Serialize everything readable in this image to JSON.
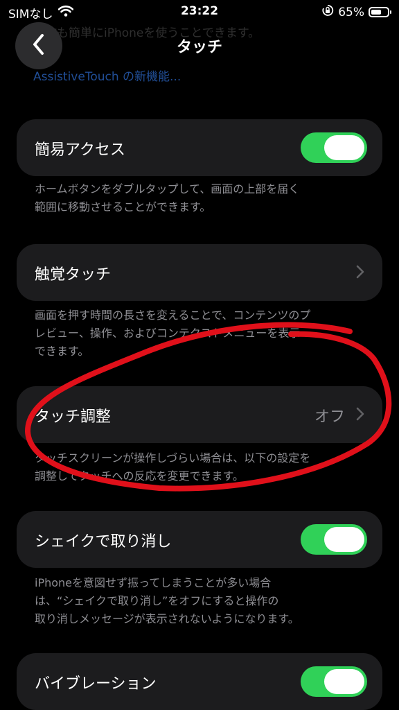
{
  "status": {
    "carrier": "SIMなし",
    "time": "23:22",
    "battery": "65%",
    "battery_level": 0.65
  },
  "background_text": {
    "line": "操作も簡単にiPhoneを使うことできます。",
    "link": "AssistiveTouch の新機能..."
  },
  "nav": {
    "title": "タッチ"
  },
  "rows": {
    "reachability": {
      "label": "簡易アクセス",
      "footer_lines": [
        "ホームボタンをダブルタップして、画面の上部を届く",
        "範囲に移動させることができます。"
      ],
      "on": true
    },
    "haptic": {
      "label": "触覚タッチ",
      "footer_lines": [
        "画面を押す時間の長さを変えることで、コンテンツのプ",
        "レビュー、操作、およびコンテクストメニューを表示",
        "できます。"
      ]
    },
    "touch_accommodations": {
      "label": "タッチ調整",
      "value": "オフ",
      "footer_lines": [
        "タッチスクリーンが操作しづらい場合は、以下の設定を",
        "調整してタッチへの反応を変更できます。"
      ]
    },
    "shake_to_undo": {
      "label": "シェイクで取り消し",
      "footer_lines": [
        "iPhoneを意図せず振ってしまうことが多い場合",
        "は、“シェイクで取り消し”をオフにすると操作の",
        "取り消しメッセージが表示されないようになります。"
      ],
      "on": true
    },
    "vibration": {
      "label": "バイブレーション",
      "on": true
    }
  },
  "colors": {
    "toggle_on": "#30d158",
    "annotation": "#e0101a",
    "cell_bg": "#1c1c1e"
  },
  "icons": [
    "wifi-icon",
    "orientation-lock-icon",
    "battery-icon",
    "back-chevron-icon",
    "chevron-right-icon"
  ]
}
